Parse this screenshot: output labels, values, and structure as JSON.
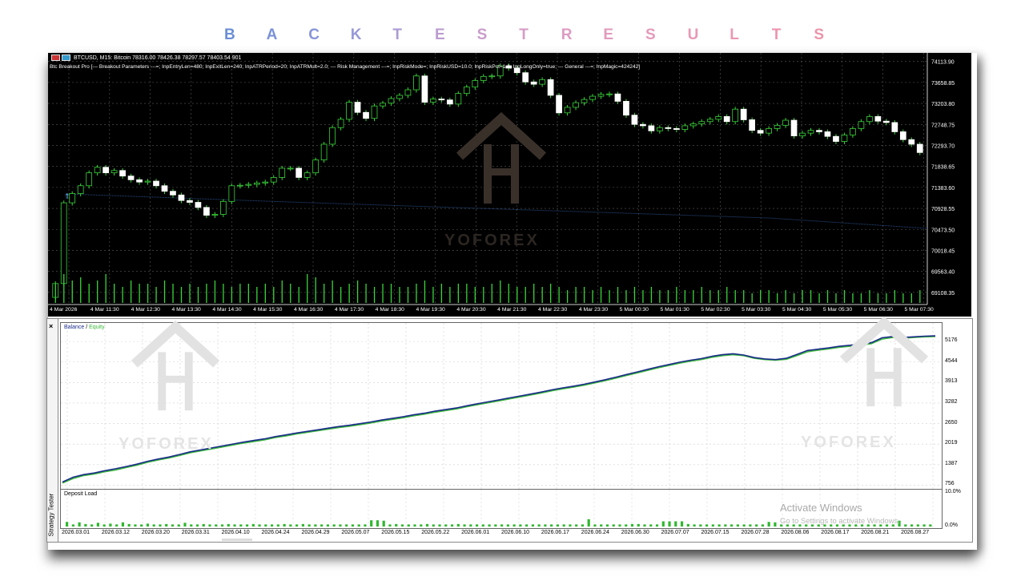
{
  "banner": {
    "letters": [
      "B",
      "A",
      "C",
      "K",
      "T",
      "E",
      "S",
      "T",
      "R",
      "E",
      "S",
      "U",
      "L",
      "T",
      "S"
    ],
    "colors": [
      "#6b8fd6",
      "#7a92d8",
      "#8795d8",
      "#9799d8",
      "#aa9bd4",
      "#bb9cd0",
      "#c99ccc",
      "#d59cc6",
      "#dd9bc2",
      "#e19bbd",
      "#e59aba",
      "#e898b6",
      "#ea97b2",
      "#ec96ae",
      "#ec95aa"
    ]
  },
  "price_chart": {
    "title": "BTCUSD, M15:  Bitcoin  78316.00 78426.38 78297.57 78403.54  901",
    "params": "Btc Breakout Pro [--- Breakout Parameters ---=; InpEntryLen=480; InpExitLen=240; InpATRPeriod=20; InpATRMult=2.0; --- Risk Management ---=; InpRiskMode=; InpRiskUSD=10.0; InpRiskPct=1.0; InpLongOnly=true; --- General ---=; InpMagic=424242]",
    "y_labels": [
      "74113.90",
      "73658.85",
      "73203.80",
      "72748.75",
      "72293.70",
      "71838.65",
      "71383.60",
      "70928.55",
      "70473.50",
      "70018.45",
      "69563.40",
      "69108.35"
    ],
    "x_labels": [
      "4 Mar 2026",
      "4 Mar 11:30",
      "4 Mar 12:30",
      "4 Mar 13:30",
      "4 Mar 14:30",
      "4 Mar 15:30",
      "4 Mar 16:30",
      "4 Mar 17:30",
      "4 Mar 18:30",
      "4 Mar 19:30",
      "4 Mar 20:30",
      "4 Mar 21:30",
      "4 Mar 22:30",
      "4 Mar 23:30",
      "5 Mar 00:30",
      "5 Mar 01:30",
      "5 Mar 02:30",
      "5 Mar 03:30",
      "5 Mar 04:30",
      "5 Mar 05:30",
      "5 Mar 06:30",
      "5 Mar 07:30"
    ],
    "ylim": [
      68880,
      74230
    ],
    "closes": [
      69300,
      71050,
      71250,
      71420,
      71700,
      71820,
      71700,
      71750,
      71630,
      71550,
      71500,
      71520,
      71420,
      71300,
      71220,
      71100,
      71060,
      70950,
      70780,
      70800,
      71080,
      71420,
      71430,
      71450,
      71480,
      71500,
      71600,
      71800,
      71800,
      71600,
      71700,
      71980,
      72320,
      72680,
      72860,
      73230,
      73010,
      72880,
      73150,
      73210,
      73310,
      73380,
      73500,
      73800,
      73230,
      73300,
      73280,
      73190,
      73420,
      73560,
      73700,
      73790,
      73800,
      74020,
      73970,
      73870,
      73670,
      73620,
      73720,
      73380,
      73000,
      73120,
      73220,
      73290,
      73360,
      73400,
      73410,
      73250,
      72950,
      72750,
      72720,
      72610,
      72680,
      72660,
      72640,
      72720,
      72760,
      72810,
      72860,
      72920,
      72810,
      73080,
      72850,
      72620,
      72560,
      72660,
      72730,
      72840,
      72500,
      72560,
      72620,
      72590,
      72490,
      72380,
      72520,
      72660,
      72810,
      72920,
      72820,
      72790,
      72590,
      72420,
      72320,
      72140
    ],
    "volumes": [
      0.6,
      0.9,
      0.7,
      0.8,
      0.6,
      0.7,
      0.9,
      0.6,
      0.5,
      0.7,
      0.6,
      0.6,
      0.5,
      0.7,
      0.6,
      0.5,
      0.6,
      0.5,
      0.6,
      0.7,
      0.6,
      0.5,
      0.6,
      0.6,
      0.5,
      0.6,
      0.5,
      0.7,
      0.6,
      0.5,
      0.9,
      0.8,
      0.6,
      0.7,
      0.5,
      0.6,
      0.7,
      0.6,
      0.5,
      0.6,
      0.6,
      0.5,
      0.5,
      0.6,
      0.7,
      0.5,
      0.6,
      0.5,
      0.6,
      0.6,
      0.5,
      0.5,
      0.6,
      0.7,
      0.6,
      0.5,
      0.5,
      0.6,
      0.5,
      0.6,
      0.5,
      0.4,
      0.5,
      0.5,
      0.4,
      0.5,
      0.4,
      0.5,
      0.4,
      0.5,
      0.4,
      0.5,
      0.4,
      0.4,
      0.5,
      0.4,
      0.4,
      0.5,
      0.4,
      0.4,
      0.5,
      0.4,
      0.4,
      0.3,
      0.4,
      0.4,
      0.3,
      0.4,
      0.3,
      0.4,
      0.4,
      0.3,
      0.4,
      0.3,
      0.4,
      0.3,
      0.3,
      0.4,
      0.3,
      0.3,
      0.4,
      0.3,
      0.3,
      0.4
    ]
  },
  "tester": {
    "panel_label": "Strategy Tester",
    "close_glyph": "×",
    "legend_balance": "Balance",
    "legend_sep": " / ",
    "legend_equity": "Equity",
    "balance_color": "#1b2c8a",
    "equity_color": "#3cb83a",
    "y_labels": [
      "5176",
      "4544",
      "3913",
      "3282",
      "2650",
      "2019",
      "1387",
      "756"
    ],
    "ylim": [
      740,
      5500
    ],
    "balance": [
      850,
      1000,
      1080,
      1130,
      1200,
      1260,
      1330,
      1400,
      1490,
      1560,
      1620,
      1700,
      1780,
      1840,
      1900,
      1960,
      2020,
      2080,
      2130,
      2180,
      2250,
      2300,
      2360,
      2410,
      2460,
      2510,
      2560,
      2600,
      2650,
      2700,
      2760,
      2810,
      2860,
      2920,
      2970,
      3030,
      3080,
      3130,
      3200,
      3260,
      3320,
      3380,
      3440,
      3500,
      3560,
      3620,
      3690,
      3750,
      3800,
      3860,
      3930,
      4000,
      4080,
      4160,
      4240,
      4320,
      4400,
      4470,
      4540,
      4600,
      4650,
      4720,
      4770,
      4800,
      4760,
      4680,
      4640,
      4620,
      4660,
      4780,
      4900,
      4940,
      4980,
      5030,
      5060,
      5100,
      5140,
      5290,
      5330,
      5300,
      5320,
      5340,
      5350
    ],
    "equity": [
      820,
      960,
      1050,
      1100,
      1170,
      1220,
      1300,
      1370,
      1460,
      1530,
      1590,
      1670,
      1750,
      1810,
      1870,
      1930,
      1990,
      2050,
      2100,
      2150,
      2220,
      2270,
      2330,
      2380,
      2430,
      2480,
      2530,
      2570,
      2620,
      2670,
      2730,
      2780,
      2830,
      2890,
      2940,
      3000,
      3050,
      3100,
      3170,
      3230,
      3290,
      3350,
      3410,
      3470,
      3530,
      3590,
      3660,
      3720,
      3770,
      3830,
      3900,
      3970,
      4050,
      4130,
      4210,
      4290,
      4370,
      4440,
      4510,
      4570,
      4620,
      4690,
      4740,
      4770,
      4740,
      4660,
      4620,
      4600,
      4630,
      4740,
      4860,
      4910,
      4950,
      5000,
      5030,
      5070,
      5110,
      5250,
      5300,
      5280,
      5300,
      5320,
      5330
    ],
    "deposit_title": "Deposit Load",
    "deposit_max": "10.0%",
    "deposit_min": "0.0%",
    "deposit_bars": [
      0.22,
      0.1,
      0.2,
      0.12,
      0.1,
      0.18,
      0.1,
      0.14,
      0.1,
      0.2,
      0.12,
      0.1,
      0.1,
      0.14,
      0.1,
      0.1,
      0.12,
      0.1,
      0.1,
      0.18,
      0.1,
      0.1,
      0.12,
      0.1,
      0.1,
      0.1,
      0.12,
      0.1,
      0.1,
      0.1,
      0.12,
      0.1,
      0.1,
      0.1,
      0.1,
      0.12,
      0.1,
      0.1,
      0.12,
      0.1,
      0.1,
      0.1,
      0.1,
      0.1,
      0.1,
      0.1,
      0.1,
      0.1,
      0.1,
      0.3,
      0.3,
      0.28,
      0.1,
      0.12,
      0.1,
      0.1,
      0.1,
      0.1,
      0.12,
      0.1,
      0.1,
      0.1,
      0.1,
      0.12,
      0.1,
      0.1,
      0.1,
      0.1,
      0.1,
      0.1,
      0.1,
      0.1,
      0.1,
      0.1,
      0.1,
      0.1,
      0.1,
      0.1,
      0.1,
      0.1,
      0.1,
      0.1,
      0.1,
      0.1,
      0.35,
      0.1,
      0.1,
      0.1,
      0.1,
      0.1,
      0.1,
      0.12,
      0.12,
      0.1,
      0.1,
      0.1,
      0.25,
      0.25,
      0.25,
      0.25,
      0.12,
      0.1,
      0.1,
      0.1,
      0.1,
      0.1,
      0.1,
      0.1,
      0.1,
      0.1,
      0.1,
      0.1,
      0.1,
      0.22,
      0.2,
      0.1,
      0.1,
      0.1,
      0.1,
      0.1,
      0.1,
      0.1,
      0.1,
      0.1,
      0.1,
      0.1,
      0.1,
      0.1,
      0.1,
      0.1,
      0.1,
      0.1,
      0.1,
      0.1,
      0.28,
      0.1,
      0.1,
      0.1,
      0.1,
      0.1
    ],
    "x_labels": [
      "2026.03.01",
      "2026.03.12",
      "2026.03.20",
      "2026.03.31",
      "2026.04.10",
      "2026.04.24",
      "2026.04.29",
      "2026.05.07",
      "2026.05.15",
      "2026.05.22",
      "2026.06.01",
      "2026.06.10",
      "2026.06.17",
      "2026.06.24",
      "2026.06.30",
      "2026.07.07",
      "2026.07.15",
      "2026.07.28",
      "2026.08.06",
      "2026.08.17",
      "2026.08.21",
      "2026.08.27"
    ]
  },
  "watermark": {
    "text": "YOFOREX"
  },
  "windows_notice": {
    "line1": "Activate Windows",
    "line2": "Go to Settings to activate Windows."
  }
}
